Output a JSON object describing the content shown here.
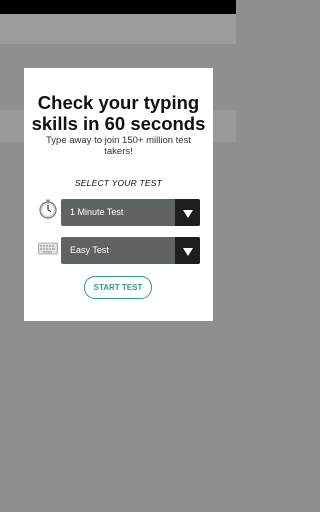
{
  "modal": {
    "title_line1": "Check your typing",
    "title_line2": "skills in 60 seconds",
    "subtitle": "Type away to join 150+ million test takers!",
    "section_label": "SELECT YOUR TEST",
    "duration_select": {
      "value": "1 Minute Test",
      "icon": "stopwatch-icon"
    },
    "difficulty_select": {
      "value": "Easy Test",
      "icon": "keyboard-icon"
    },
    "start_button_label": "START TEST"
  },
  "colors": {
    "overlay": "#8f8f8f",
    "select_bg": "#5f6462",
    "select_arrow_bg": "#1e1e1e",
    "accent": "#2f9e8a"
  }
}
